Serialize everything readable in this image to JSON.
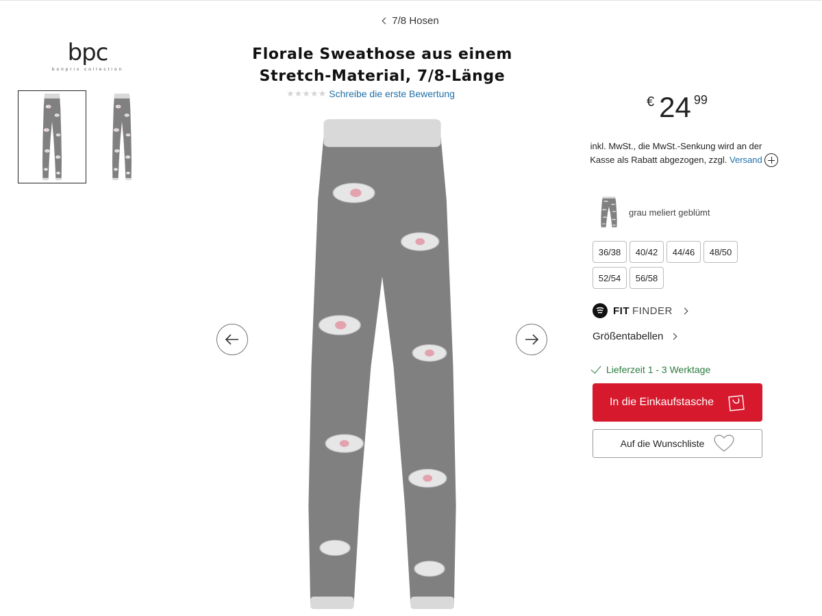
{
  "breadcrumb": {
    "label": "7/8 Hosen"
  },
  "brand": {
    "name": "bpc",
    "subline": "bonprix collection"
  },
  "product": {
    "title": "Florale Sweathose aus einem Stretch-Material, 7/8-Länge",
    "rating_stars": 0,
    "rating_link": "Schreibe die erste Bewertung",
    "colors": {
      "fabric": "#808080",
      "cuff": "#d9d9d9",
      "drawstring": "#6e6e6e"
    }
  },
  "price": {
    "currency": "€",
    "integer": "24",
    "decimals": "99"
  },
  "tax": {
    "text": "inkl. MwSt., die MwSt.-Senkung wird an der Kasse als Rabatt abgezogen, zzgl.",
    "link": "Versand"
  },
  "color_variant": {
    "label": "grau meliert geblümt"
  },
  "sizes": [
    "36/38",
    "40/42",
    "44/46",
    "48/50",
    "52/54",
    "56/58"
  ],
  "fit_finder": {
    "bold": "FIT",
    "light": "FINDER"
  },
  "size_table": {
    "label": "Größentabellen"
  },
  "delivery": {
    "label": "Lieferzeit 1 - 3 Werktage"
  },
  "cart_button": {
    "label": "In die Einkaufstasche"
  },
  "wishlist_button": {
    "label": "Auf die Wunschliste"
  },
  "accent": {
    "red": "#d7192d",
    "link": "#1f6fa8",
    "green": "#2a7a3e"
  }
}
